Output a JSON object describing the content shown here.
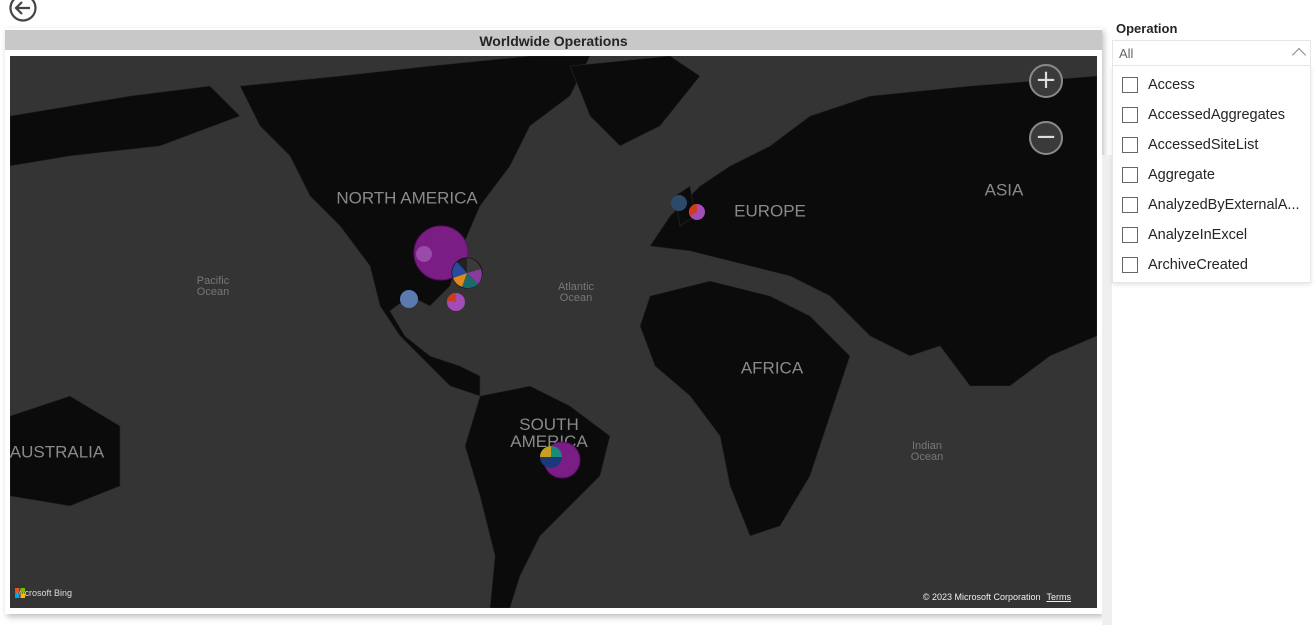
{
  "visual": {
    "title": "Worldwide Operations"
  },
  "map": {
    "labels": {
      "north_america": "NORTH AMERICA",
      "europe": "EUROPE",
      "asia": "ASIA",
      "africa": "AFRICA",
      "south_america": "SOUTH AMERICA",
      "australia": "AUSTRALIA",
      "pacific": "Pacific Ocean",
      "atlantic": "Atlantic Ocean",
      "indian": "Indian Ocean"
    },
    "zoom_in": "+",
    "zoom_out": "−",
    "attribution": "Microsoft Bing",
    "copyright": "© 2023 Microsoft Corporation",
    "terms": "Terms",
    "colors": {
      "land": "#0b0b0b",
      "ocean": "#343434",
      "bubble_primary": "#7a1e86"
    }
  },
  "slicer": {
    "title": "Operation",
    "selected": "All",
    "items": [
      "Access",
      "AccessedAggregates",
      "AccessedSiteList",
      "Aggregate",
      "AnalyzedByExternalA...",
      "AnalyzeInExcel",
      "ArchiveCreated"
    ]
  }
}
